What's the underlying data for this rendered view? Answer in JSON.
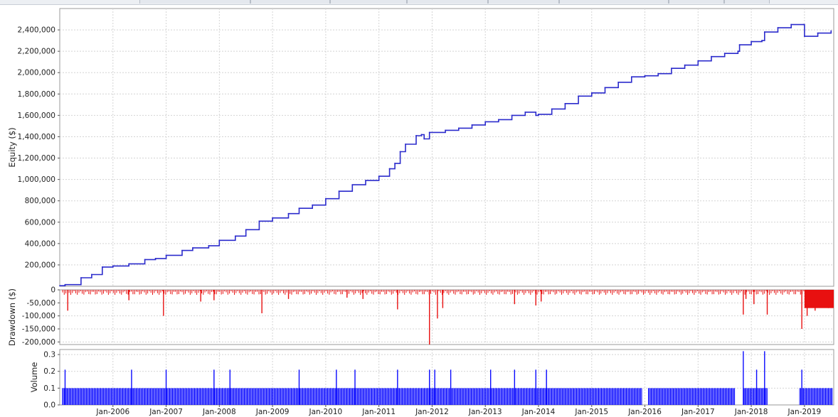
{
  "colors": {
    "equity_line": "#2b2bcc",
    "drawdown_bars": "#e81010",
    "volume_bars": "#0a0aff",
    "grid": "#d4d4d4",
    "frame": "#9a9a9a"
  },
  "chart_data": [
    {
      "type": "line",
      "panel": "equity",
      "ylabel": "Equity ($)",
      "ylim": [
        0,
        2600000
      ],
      "yticks": [
        200000,
        400000,
        600000,
        800000,
        1000000,
        1200000,
        1400000,
        1600000,
        1800000,
        2000000,
        2200000,
        2400000
      ],
      "ytick_labels": [
        "200,000",
        "400,000",
        "600,000",
        "800,000",
        "1,000,000",
        "1,200,000",
        "1,400,000",
        "1,600,000",
        "1,800,000",
        "2,000,000",
        "2,200,000",
        "2,400,000"
      ],
      "grid": true,
      "series": [
        {
          "x": [
            2005.0,
            2005.1,
            2005.4,
            2005.6,
            2005.8,
            2006.0,
            2006.3,
            2006.6,
            2006.8,
            2007.0,
            2007.3,
            2007.5,
            2007.8,
            2008.0,
            2008.3,
            2008.5,
            2008.75,
            2009.0,
            2009.3,
            2009.5,
            2009.75,
            2010.0,
            2010.25,
            2010.5,
            2010.75,
            2011.0,
            2011.2,
            2011.3,
            2011.4,
            2011.5,
            2011.7,
            2011.8,
            2011.85,
            2011.95,
            2012.25,
            2012.5,
            2012.75,
            2013.0,
            2013.25,
            2013.5,
            2013.75,
            2013.95,
            2014.0,
            2014.25,
            2014.5,
            2014.75,
            2015.0,
            2015.25,
            2015.5,
            2015.75,
            2016.0,
            2016.25,
            2016.5,
            2016.75,
            2017.0,
            2017.25,
            2017.5,
            2017.75,
            2017.78,
            2018.0,
            2018.2,
            2018.25,
            2018.5,
            2018.75,
            2018.98,
            2019.0,
            2019.25,
            2019.5
          ],
          "y": [
            5000,
            15000,
            80000,
            110000,
            180000,
            190000,
            210000,
            250000,
            260000,
            290000,
            335000,
            360000,
            380000,
            430000,
            470000,
            530000,
            610000,
            640000,
            680000,
            730000,
            760000,
            820000,
            890000,
            950000,
            990000,
            1030000,
            1100000,
            1150000,
            1260000,
            1330000,
            1410000,
            1420000,
            1380000,
            1440000,
            1460000,
            1480000,
            1510000,
            1540000,
            1560000,
            1600000,
            1630000,
            1600000,
            1610000,
            1660000,
            1710000,
            1780000,
            1810000,
            1860000,
            1910000,
            1960000,
            1970000,
            1990000,
            2040000,
            2070000,
            2110000,
            2150000,
            2180000,
            2200000,
            2260000,
            2290000,
            2300000,
            2380000,
            2420000,
            2450000,
            2450000,
            2340000,
            2370000,
            2390000
          ]
        }
      ]
    },
    {
      "type": "bar",
      "panel": "drawdown",
      "ylabel": "Drawdown ($)",
      "ylim": [
        -210000,
        0
      ],
      "yticks": [
        0,
        -50000,
        -100000,
        -150000,
        -200000
      ],
      "ytick_labels": [
        "0",
        "-50,000",
        "-100,000",
        "-150,000",
        "-200,000"
      ],
      "grid": true,
      "x": [
        2005.15,
        2006.3,
        2006.95,
        2007.65,
        2007.9,
        2008.8,
        2009.3,
        2010.4,
        2010.7,
        2011.35,
        2011.95,
        2012.1,
        2012.2,
        2013.55,
        2013.95,
        2014.05,
        2017.85,
        2017.9,
        2018.05,
        2018.3,
        2018.95,
        2019.05,
        2019.2,
        2019.45
      ],
      "values": [
        -80000,
        -40000,
        -100000,
        -45000,
        -40000,
        -90000,
        -35000,
        -30000,
        -35000,
        -75000,
        -210000,
        -110000,
        -70000,
        -55000,
        -60000,
        -45000,
        -95000,
        -35000,
        -55000,
        -95000,
        -150000,
        -100000,
        -80000,
        -70000
      ]
    },
    {
      "type": "bar",
      "panel": "volume",
      "ylabel": "Volume",
      "ylim": [
        0,
        0.33
      ],
      "yticks": [
        0.0,
        0.1,
        0.2,
        0.3
      ],
      "ytick_labels": [
        "0.0",
        "0.1",
        "0.2",
        "0.3"
      ],
      "xlim": [
        2005.0,
        2019.55
      ],
      "x_tick_values": [
        2006.0,
        2007.0,
        2008.0,
        2009.0,
        2010.0,
        2011.0,
        2012.0,
        2013.0,
        2014.0,
        2015.0,
        2016.0,
        2017.0,
        2018.0,
        2019.0
      ],
      "xtick_labels": [
        "Jan-2006",
        "Jan-2007",
        "Jan-2008",
        "Jan-2009",
        "Jan-2010",
        "Jan-2011",
        "Jan-2012",
        "Jan-2013",
        "Jan-2014",
        "Jan-2015",
        "Jan-2016",
        "Jan-2017",
        "Jan-2018",
        "Jan-2019"
      ],
      "grid": true,
      "baseline_value": 0.1,
      "x": [
        2005.1,
        2006.35,
        2007.0,
        2007.9,
        2008.2,
        2009.5,
        2010.2,
        2010.55,
        2011.35,
        2011.95,
        2012.05,
        2012.35,
        2013.1,
        2013.55,
        2013.95,
        2014.15,
        2017.85,
        2018.1,
        2018.25,
        2018.95
      ],
      "values": [
        0.21,
        0.21,
        0.21,
        0.21,
        0.21,
        0.21,
        0.21,
        0.21,
        0.21,
        0.21,
        0.21,
        0.21,
        0.21,
        0.21,
        0.21,
        0.21,
        0.32,
        0.21,
        0.32,
        0.21
      ]
    }
  ]
}
